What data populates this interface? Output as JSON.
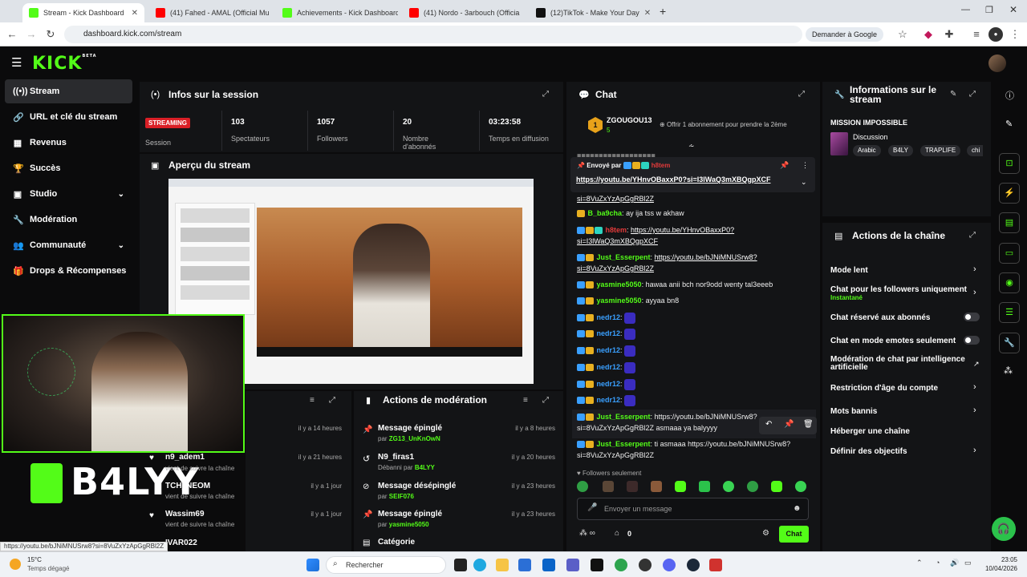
{
  "browser": {
    "tabs": [
      {
        "title": "Stream - Kick Dashboard",
        "color": "#53fc18"
      },
      {
        "title": "(41) Fahed - AMAL (Official Mu",
        "color": "#ff0000"
      },
      {
        "title": "Achievements - Kick Dashboard",
        "color": "#53fc18"
      },
      {
        "title": "(41) Nordo - 3arbouch (Officia",
        "color": "#ff0000"
      },
      {
        "title": "(12)TikTok - Make Your Day",
        "color": "#111111"
      }
    ],
    "new_tab": "+",
    "url": "dashboard.kick.com/stream",
    "google_button": "Demander à Google"
  },
  "kick": {
    "logo": "KICK",
    "logo_sup": "BETA"
  },
  "sidebar": {
    "items": [
      {
        "label": "Stream",
        "icon": "broadcast-icon",
        "glyph": "▶",
        "active": true
      },
      {
        "label": "URL et clé du stream",
        "icon": "link-icon",
        "glyph": "🔗"
      },
      {
        "label": "Revenus",
        "icon": "revenue-icon",
        "glyph": "▦"
      },
      {
        "label": "Succès",
        "icon": "trophy-icon",
        "glyph": "🏆"
      },
      {
        "label": "Studio",
        "icon": "studio-icon",
        "glyph": "▣",
        "chevron": "⌄"
      },
      {
        "label": "Modération",
        "icon": "wrench-icon",
        "glyph": "🔧"
      },
      {
        "label": "Communauté",
        "icon": "community-icon",
        "glyph": "👥",
        "chevron": "⌄"
      },
      {
        "label": "Drops & Récompenses",
        "icon": "gift-icon",
        "glyph": "🎁"
      }
    ]
  },
  "session": {
    "title": "Infos sur la session",
    "streaming_badge": "STREAMING",
    "session_label": "Session",
    "stats": [
      {
        "value": "103",
        "label": "Spectateurs"
      },
      {
        "value": "1057",
        "label": "Followers"
      },
      {
        "value": "20",
        "label": "Nombre d'abonnés"
      },
      {
        "value": "03:23:58",
        "label": "Temps en diffusion"
      }
    ]
  },
  "preview": {
    "title": "Aperçu du stream"
  },
  "overlay": {
    "brand_text": "B4LYY"
  },
  "activity": {
    "rows": [
      {
        "name": "",
        "sub": "",
        "time": "il y a 14 heures"
      },
      {
        "name": "n9_adem1",
        "sub": "vient de suivre la chaîne",
        "time": "il y a 21 heures"
      },
      {
        "name": "TCH_NEOM",
        "sub": "vient de suivre la chaîne",
        "time": "il y a 1 jour"
      },
      {
        "name": "Wassim69",
        "sub": "vient de suivre la chaîne",
        "time": "il y a 1 jour"
      },
      {
        "name": "IVAR022",
        "sub": "",
        "time": ""
      }
    ]
  },
  "moderation": {
    "title": "Actions de modération",
    "rows": [
      {
        "title": "Message épinglé",
        "prefix": "par",
        "user": "ZG13_UnKnOwN",
        "time": "il y a 8 heures",
        "icon": "pin-icon",
        "glyph": "📌"
      },
      {
        "title": "N9_firas1",
        "prefix": "Débanni par",
        "user": "B4LYY",
        "time": "il y a 20 heures",
        "icon": "undo-icon",
        "glyph": "↺"
      },
      {
        "title": "Message désépinglé",
        "prefix": "par",
        "user": "SEIF076",
        "time": "il y a 23 heures",
        "icon": "unpin-icon",
        "glyph": "⊘"
      },
      {
        "title": "Message épinglé",
        "prefix": "par",
        "user": "yasmine5050",
        "time": "il y a 23 heures",
        "icon": "pin-icon",
        "glyph": "📌"
      },
      {
        "title": "Catégorie",
        "prefix": "",
        "user": "",
        "time": "",
        "icon": "category-icon",
        "glyph": "▤"
      }
    ]
  },
  "chat": {
    "title": "Chat",
    "top_gifter": {
      "name": "ZGOUGOU13",
      "count": "5",
      "rank": "1"
    },
    "gift_text": "Offrir 1 abonnement pour prendre la 2ème",
    "pinned": {
      "sent_by": "Envoyé par",
      "user": "h8tem",
      "link": "https://youtu.be/YHnvOBaxxP0?si=I3lWaQ3mXBQgpXCF"
    },
    "messages": [
      {
        "user": "",
        "text": "si=8VuZxYzApGgRBl2Z",
        "link": true,
        "color": "#fff"
      },
      {
        "user": "B_ba9cha",
        "text": "ay ija tss w akhaw",
        "color": "#53fc18",
        "badges": 1
      },
      {
        "user": "h8tem",
        "text": "https://youtu.be/YHnvOBaxxP0?si=I3lWaQ3mXBQgpXCF",
        "link": true,
        "color": "#e23a3a",
        "badges": 3
      },
      {
        "user": "Just_Esserpent",
        "text": "https://youtu.be/bJNiMNUSrw8?si=8VuZxYzApGgRBl2Z",
        "link": true,
        "color": "#53fc18",
        "badges": 2
      },
      {
        "user": "yasmine5050",
        "text": "hawaa anii bch nor9odd wenty tal3eeeb",
        "color": "#53fc18",
        "badges": 2
      },
      {
        "user": "yasmine5050",
        "text": "ayyaa bn8",
        "color": "#53fc18",
        "badges": 2
      },
      {
        "user": "nedr12",
        "text": "",
        "emote": true,
        "color": "#3aa0ff",
        "badges": 2
      },
      {
        "user": "nedr12",
        "text": "",
        "emote": true,
        "color": "#3aa0ff",
        "badges": 2
      },
      {
        "user": "nedr12",
        "text": "",
        "emote": true,
        "color": "#3aa0ff",
        "badges": 2
      },
      {
        "user": "nedr12",
        "text": "",
        "emote": true,
        "color": "#3aa0ff",
        "badges": 2
      },
      {
        "user": "nedr12",
        "text": "",
        "emote": true,
        "color": "#3aa0ff",
        "badges": 2
      },
      {
        "user": "nedr12",
        "text": "",
        "emote": true,
        "color": "#3aa0ff",
        "badges": 2
      },
      {
        "user": "Just_Esserpent",
        "text": "https://youtu.be/bJNiMNUSrw8?si=8VuZxYzApGgRBl2Z asmaaa ya balyyyy",
        "link": true,
        "color": "#53fc18",
        "badges": 2
      },
      {
        "user": "Just_Esserpent",
        "text": "ti asmaaa https://youtu.be/bJNiMNUSrw8?si=8VuZxYzApGgRBl2Z",
        "link": false,
        "color": "#53fc18",
        "badges": 2
      }
    ],
    "followers_only": "Followers seulement",
    "input_placeholder": "Envoyer un message",
    "points": "0",
    "send_button": "Chat"
  },
  "stream_info": {
    "title": "Informations sur le stream",
    "mission": "MISSION IMPOSSIBLE",
    "category": "Discussion",
    "tags": [
      "Arabic",
      "B4LY",
      "TRAPLIFE",
      "chi"
    ]
  },
  "channel_actions": {
    "title": "Actions de la chaîne",
    "items": [
      {
        "label": "Mode lent",
        "control": "chevron"
      },
      {
        "label": "Chat pour les followers uniquement",
        "sub": "Instantané",
        "control": "chevron"
      },
      {
        "label": "Chat réservé aux abonnés",
        "control": "toggle"
      },
      {
        "label": "Chat en mode emotes seulement",
        "control": "toggle"
      },
      {
        "label": "Modération de chat par intelligence artificielle",
        "control": "external"
      },
      {
        "label": "Restriction d'âge du compte",
        "control": "chevron"
      },
      {
        "label": "Mots bannis",
        "control": "chevron"
      },
      {
        "label": "Héberger une chaîne",
        "control": "none"
      },
      {
        "label": "Définir des objectifs",
        "control": "chevron"
      }
    ]
  },
  "status_link": "https://youtu.be/bJNiMNUSrw8?si=8VuZxYzApGgRBl2Z",
  "taskbar": {
    "weather_temp": "15°C",
    "weather_desc": "Temps dégagé",
    "search_placeholder": "Rechercher",
    "time": "23:05",
    "date": "10/04/2026"
  },
  "colors": {
    "accent": "#53fc18",
    "panel": "#131416",
    "background": "#0b0b0c"
  }
}
